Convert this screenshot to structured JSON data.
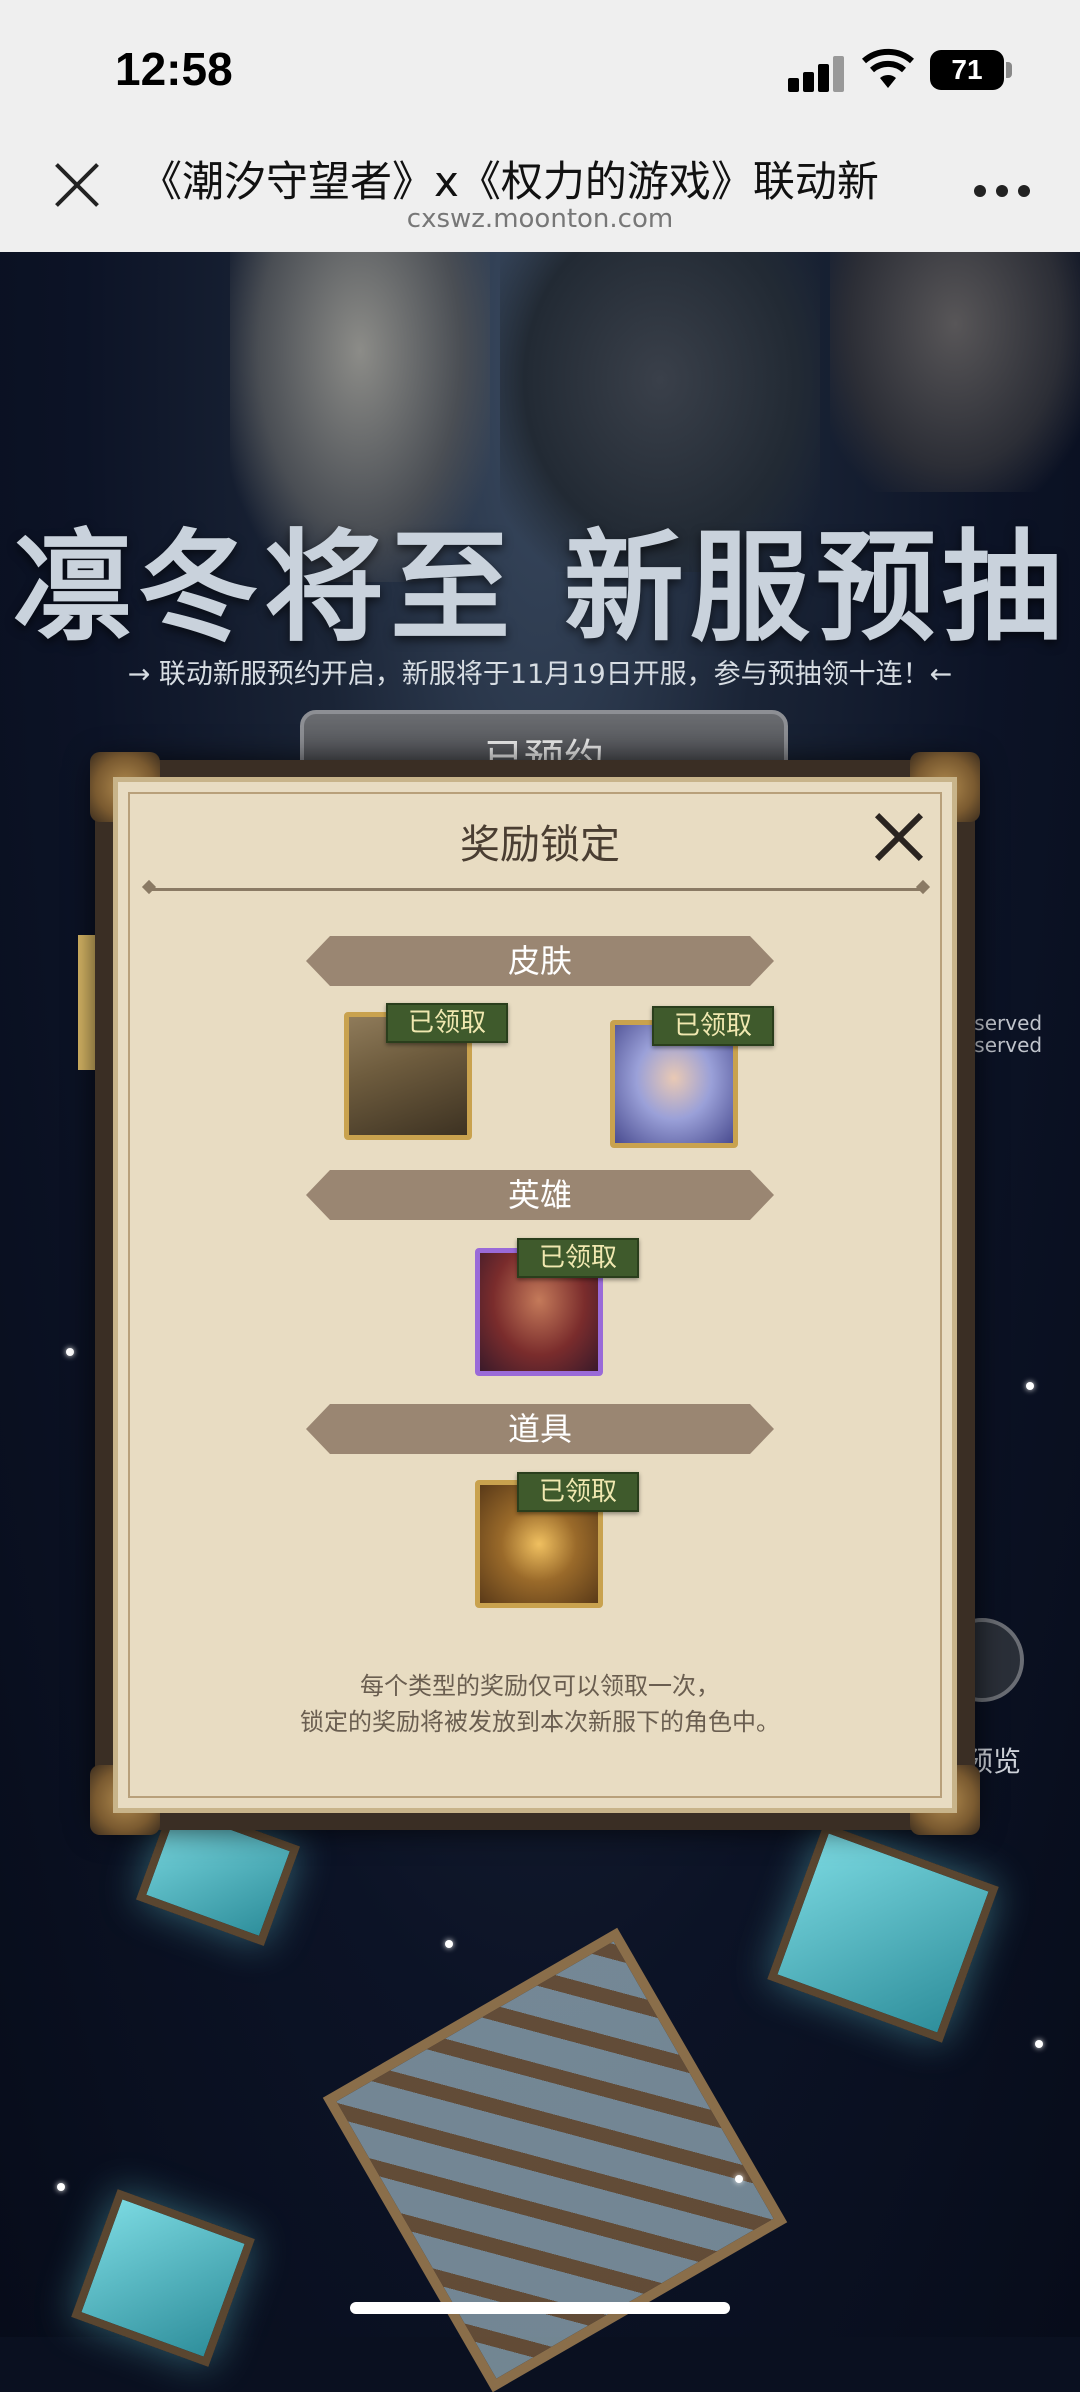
{
  "status_bar": {
    "time": "12:58",
    "battery": "71"
  },
  "browser": {
    "title": "《潮汐守望者》x《权力的游戏》联动新",
    "url": "cxswz.moonton.com"
  },
  "banner": {
    "title": "凛冬将至 新服预抽",
    "subtitle": "→ 联动新服预约开启，新服将于11月19日开服，参与预抽领十连！←",
    "reserved_button": "已预约",
    "side_text": [
      "eserved",
      "eserved"
    ],
    "preview_label": "预览"
  },
  "modal": {
    "title": "奖励锁定",
    "sections": [
      {
        "label": "皮肤",
        "items": [
          {
            "icon": "skin-armored-knight",
            "badge": "已领取"
          },
          {
            "icon": "skin-ice-queen",
            "badge": "已领取"
          }
        ]
      },
      {
        "label": "英雄",
        "items": [
          {
            "icon": "hero-red-hood-woman",
            "badge": "已领取"
          }
        ]
      },
      {
        "label": "道具",
        "items": [
          {
            "icon": "prop-golden-amulet",
            "badge": "已领取"
          }
        ]
      }
    ],
    "note_line1": "每个类型的奖励仅可以领取一次，",
    "note_line2": "锁定的奖励将被发放到本次新服下的角色中。"
  },
  "colors": {
    "modal_bg": "#e8dcc2",
    "section_band": "#9a8672",
    "claimed_badge": "#3f5a2c",
    "item_border": "#c9a24e",
    "hero_border": "#9a6ad8"
  }
}
